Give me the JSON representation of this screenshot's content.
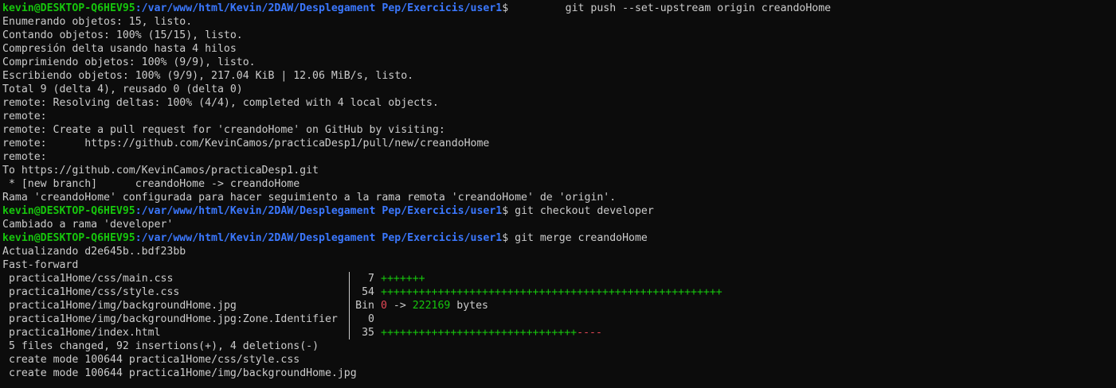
{
  "prompt": {
    "user": "kevin@DESKTOP-Q6HEV95",
    "path": ":/var/www/html/Kevin/2DAW/Desplegament Pep/Exercicis/user1",
    "symbol": "$"
  },
  "commands": {
    "push": "         git push --set-upstream origin creandoHome",
    "checkout": " git checkout developer",
    "merge": " git merge creandoHome"
  },
  "push_output": [
    "Enumerando objetos: 15, listo.",
    "Contando objetos: 100% (15/15), listo.",
    "Compresión delta usando hasta 4 hilos",
    "Comprimiendo objetos: 100% (9/9), listo.",
    "Escribiendo objetos: 100% (9/9), 217.04 KiB | 12.06 MiB/s, listo.",
    "Total 9 (delta 4), reusado 0 (delta 0)",
    "remote: Resolving deltas: 100% (4/4), completed with 4 local objects.",
    "remote:",
    "remote: Create a pull request for 'creandoHome' on GitHub by visiting:",
    "remote:      https://github.com/KevinCamos/practicaDesp1/pull/new/creandoHome",
    "remote:",
    "To https://github.com/KevinCamos/practicaDesp1.git",
    " * [new branch]      creandoHome -> creandoHome",
    "Rama 'creandoHome' configurada para hacer seguimiento a la rama remota 'creandoHome' de 'origin'."
  ],
  "checkout_output": "Cambiado a rama 'developer'",
  "merge_output": {
    "updating": "Actualizando d2e645b..bdf23bb",
    "fast_forward": "Fast-forward",
    "files": [
      {
        "name": "practica1Home/css/main.css",
        "count": "7",
        "plus": "+++++++",
        "minus": ""
      },
      {
        "name": "practica1Home/css/style.css",
        "count": "54",
        "plus": "++++++++++++++++++++++++++++++++++++++++++++++++++++++",
        "minus": ""
      },
      {
        "name": "practica1Home/img/backgroundHome.jpg",
        "count": "Bin",
        "bin_from": "0",
        "bin_arrow": " -> ",
        "bin_to": "222169",
        "bin_unit": " bytes"
      },
      {
        "name": "practica1Home/img/backgroundHome.jpg:Zone.Identifier",
        "count": "0",
        "plus": "",
        "minus": ""
      },
      {
        "name": "practica1Home/index.html",
        "count": "35",
        "plus": "+++++++++++++++++++++++++++++++",
        "minus": "----"
      }
    ],
    "summary": "5 files changed, 92 insertions(+), 4 deletions(-)",
    "create_modes": [
      "create mode 100644 practica1Home/css/style.css",
      "create mode 100644 practica1Home/img/backgroundHome.jpg"
    ]
  }
}
